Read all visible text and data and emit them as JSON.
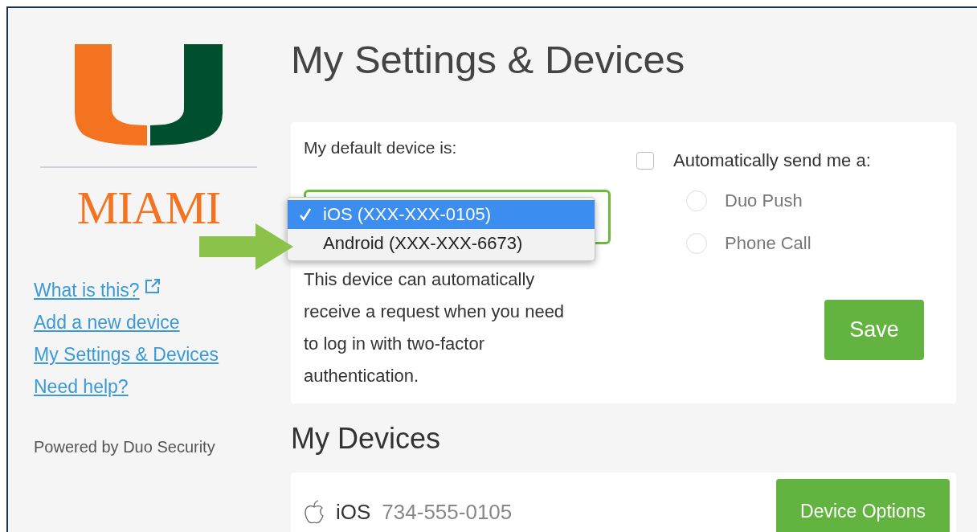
{
  "logo": {
    "wordmark": "MIAMI"
  },
  "sidebar": {
    "links": [
      {
        "label": "What is this?",
        "external": true
      },
      {
        "label": "Add a new device",
        "external": false
      },
      {
        "label": "My Settings & Devices",
        "external": false
      },
      {
        "label": "Need help?",
        "external": false
      }
    ],
    "footer": "Powered by Duo Security"
  },
  "page": {
    "title": "My Settings & Devices"
  },
  "settings": {
    "default_device_label": "My default device is:",
    "device_menu": [
      {
        "label": "iOS (XXX-XXX-0105)",
        "selected": true
      },
      {
        "label": "Android (XXX-XXX-6673)",
        "selected": false
      }
    ],
    "description": "This device can automatically receive a request when you need to log in with two-factor authentication.",
    "auto_send": {
      "label": "Automatically send me a:",
      "checked": false,
      "options": [
        {
          "label": "Duo Push",
          "selected": false
        },
        {
          "label": "Phone Call",
          "selected": false
        }
      ]
    },
    "save_button": "Save"
  },
  "devices_heading": "My Devices",
  "devices": [
    {
      "platform": "iOS",
      "number": "734-555-0105",
      "button": "Device Options"
    }
  ]
}
